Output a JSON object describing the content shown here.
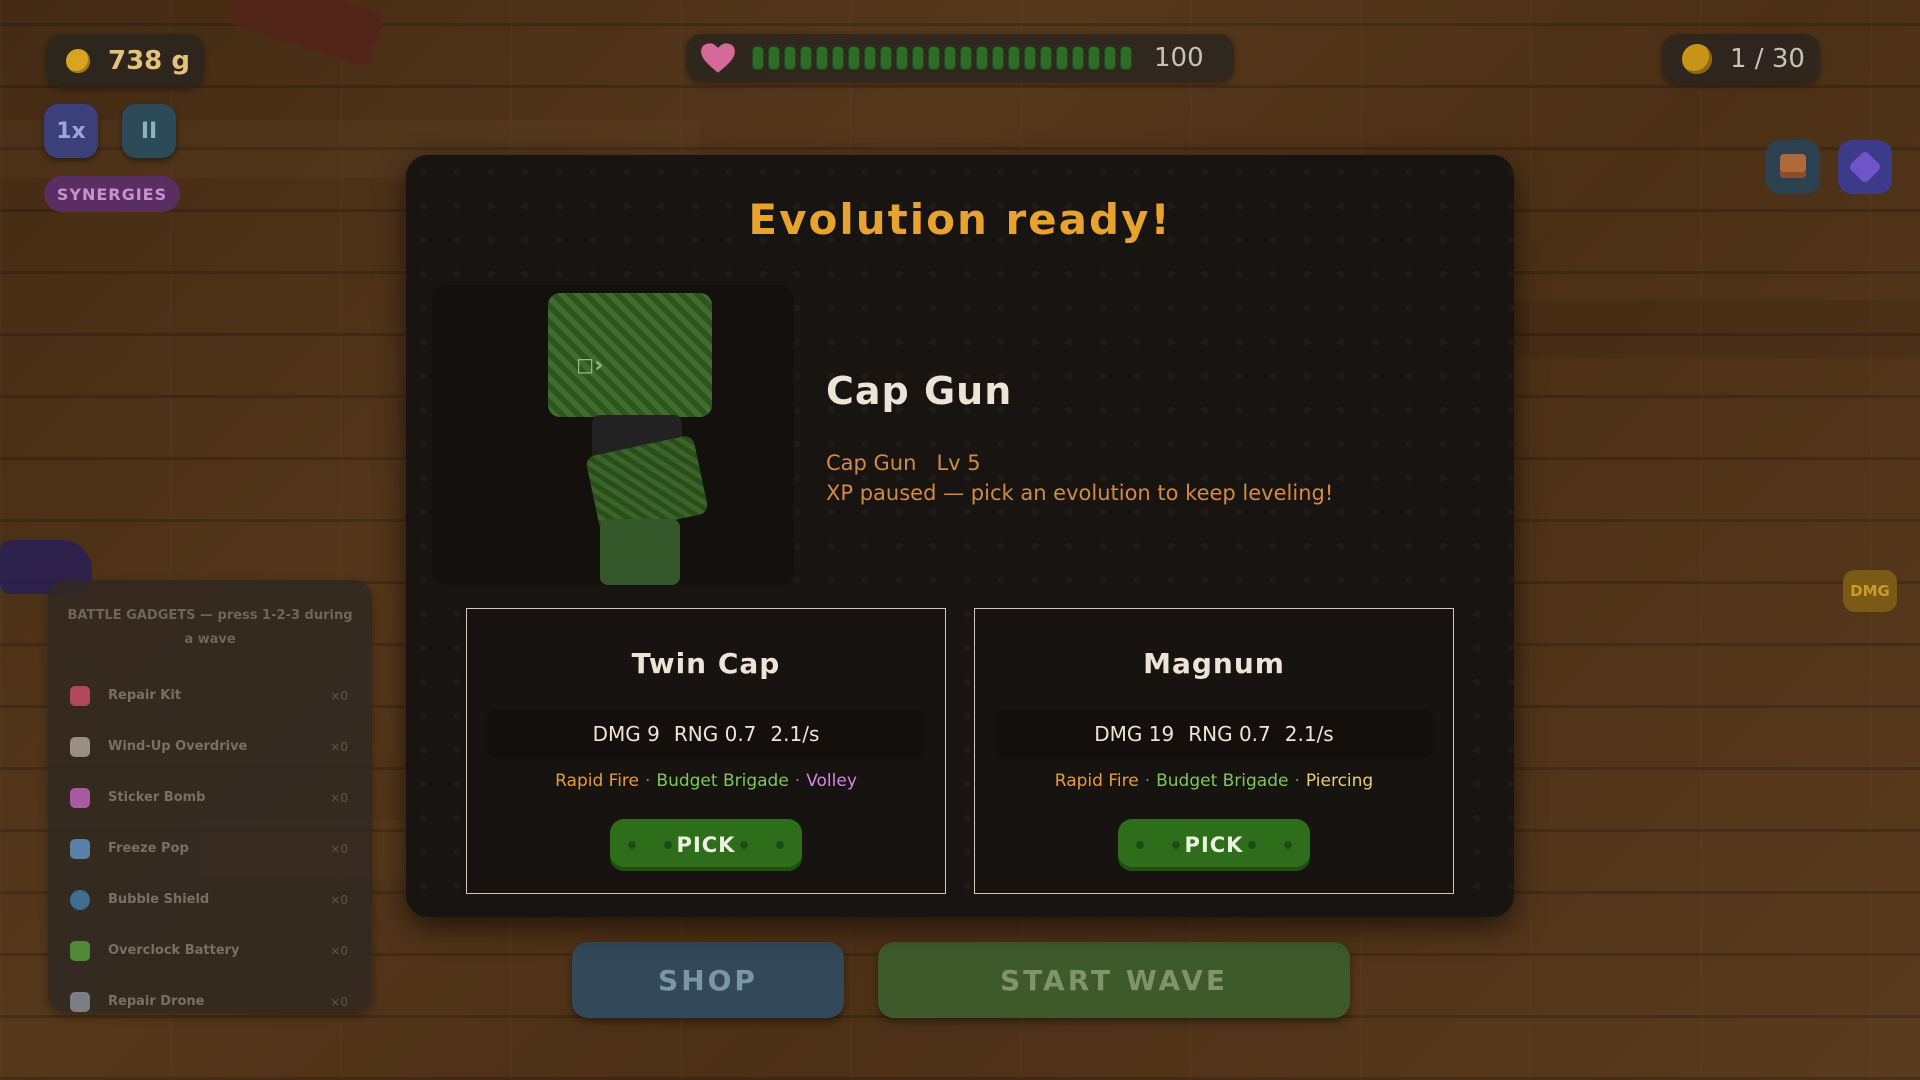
{
  "hud": {
    "gold": "738 g",
    "health_value": "100",
    "health_segments": 24,
    "wave": "1 / 30",
    "speed_label": "1x",
    "pause_label": "II",
    "synergies_label": "SYNERGIES",
    "dmg_label": "DMG"
  },
  "gadgets": {
    "title": "BATTLE GADGETS — press 1-2-3 during a wave",
    "items": [
      {
        "label": "Repair Kit",
        "count": "×0",
        "icon": "medkit-icon",
        "color": "#b0485a"
      },
      {
        "label": "Wind-Up Overdrive",
        "count": "×0",
        "icon": "windup-key-icon",
        "color": "#9a8f82"
      },
      {
        "label": "Sticker Bomb",
        "count": "×0",
        "icon": "star-icon",
        "color": "#a85aa0"
      },
      {
        "label": "Freeze Pop",
        "count": "×0",
        "icon": "popsicle-icon",
        "color": "#5a7fa8"
      },
      {
        "label": "Bubble Shield",
        "count": "×0",
        "icon": "bubble-icon",
        "color": "#3e6d8f"
      },
      {
        "label": "Overclock Battery",
        "count": "×0",
        "icon": "battery-icon",
        "color": "#4f8a3a"
      },
      {
        "label": "Repair Drone",
        "count": "×0",
        "icon": "drone-icon",
        "color": "#7a7f86"
      }
    ]
  },
  "bottom": {
    "shop_label": "SHOP",
    "start_label": "START WAVE"
  },
  "modal": {
    "title": "Evolution ready!",
    "tower_name": "Cap Gun",
    "tower_sub_name": "Cap Gun",
    "tower_level": "Lv 5",
    "note": "XP paused — pick an evolution to keep leveling!",
    "options": [
      {
        "name": "Twin Cap",
        "dmg": "DMG 9",
        "rng": "RNG 0.7",
        "rate": "2.1/s",
        "tags": [
          {
            "text": "Rapid Fire",
            "color": "#e89a3d"
          },
          {
            "text": "Budget Brigade",
            "color": "#7cc95a"
          },
          {
            "text": "Volley",
            "color": "#d486e8"
          }
        ],
        "pick_label": "PICK"
      },
      {
        "name": "Magnum",
        "dmg": "DMG 19",
        "rng": "RNG 0.7",
        "rate": "2.1/s",
        "tags": [
          {
            "text": "Rapid Fire",
            "color": "#e89a3d"
          },
          {
            "text": "Budget Brigade",
            "color": "#7cc95a"
          },
          {
            "text": "Piercing",
            "color": "#e8cc7a"
          }
        ],
        "pick_label": "PICK"
      }
    ]
  },
  "colors": {
    "accent": "#e8a22e",
    "pick_button": "#2e6e1a",
    "health": "#2f6c2a"
  }
}
